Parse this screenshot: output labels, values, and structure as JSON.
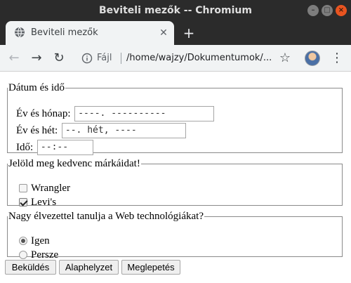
{
  "window": {
    "title": "Beviteli mezők -- Chromium"
  },
  "tab": {
    "title": "Beviteli mezők",
    "close_glyph": "✕",
    "new_tab_glyph": "+"
  },
  "toolbar": {
    "back_glyph": "←",
    "forward_glyph": "→",
    "reload_glyph": "↻",
    "scheme_label": "Fájl",
    "url": "/home/wajzy/Dokumentumok/...",
    "star_glyph": "☆",
    "menu_glyph": "⋮"
  },
  "form": {
    "datetime": {
      "legend": "Dátum és idő",
      "month_label": "Év és hónap:",
      "month_placeholder": "----. ----------",
      "week_label": "Év és hét:",
      "week_placeholder": "--. hét, ----",
      "time_label": "Idő:",
      "time_placeholder": "--:--"
    },
    "brands": {
      "legend": "Jelöld meg kedvenc márkáidat!",
      "options": [
        {
          "label": "Wrangler",
          "checked": false
        },
        {
          "label": "Levi's",
          "checked": true
        }
      ]
    },
    "survey": {
      "legend": "Nagy élvezettel tanulja a Web technológiákat?",
      "options": [
        {
          "label": "Igen",
          "selected": true
        },
        {
          "label": "Persze",
          "selected": false
        }
      ]
    },
    "buttons": {
      "submit": "Beküldés",
      "reset": "Alaphelyzet",
      "surprise": "Meglepetés"
    }
  },
  "colors": {
    "titlebar_bg": "#2b2b2b",
    "close_button": "#e95420",
    "toolbar_bg": "#f1f3f4",
    "fieldset_border": "#8a8a8a"
  }
}
